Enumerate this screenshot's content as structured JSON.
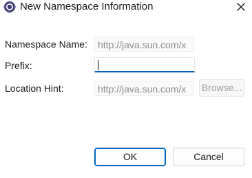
{
  "window": {
    "title": "New Namespace Information",
    "icon": "eclipse-gear-icon",
    "close_icon": "close-icon"
  },
  "form": {
    "namespace_name_label": "Namespace Name:",
    "namespace_name_value": "http://java.sun.com/x",
    "prefix_label": "Prefix:",
    "prefix_value": "",
    "location_hint_label": "Location Hint:",
    "location_hint_value": "http://java.sun.com/x",
    "browse_label": "Browse..."
  },
  "buttons": {
    "ok_label": "OK",
    "cancel_label": "Cancel"
  },
  "colors": {
    "focus_accent": "#0a5fb4",
    "default_button_border": "#0067c0",
    "disabled_text": "#8c8c8c"
  }
}
